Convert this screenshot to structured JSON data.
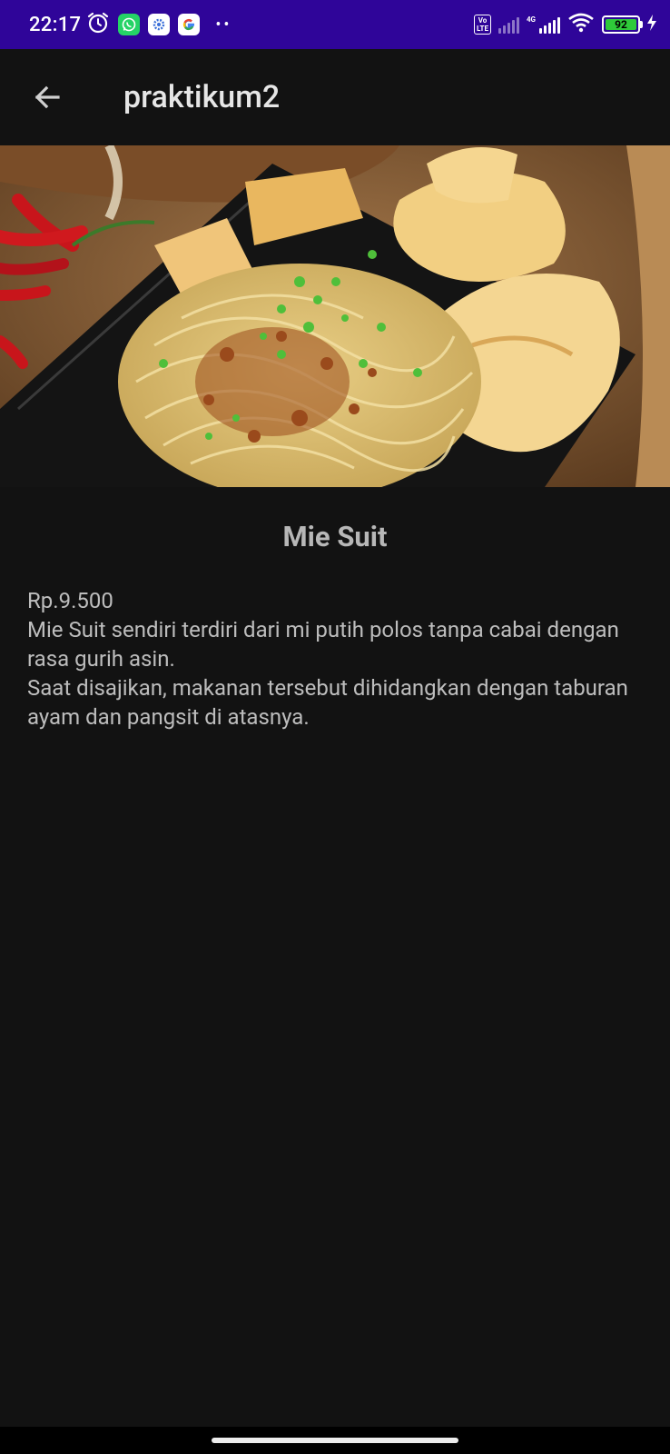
{
  "status_bar": {
    "time": "22:17",
    "icons": [
      "alarm-icon",
      "whatsapp-icon",
      "settings-app-icon",
      "google-icon"
    ],
    "more_dots": "••",
    "volte": "Vo\nLTE",
    "network": "4G",
    "battery_level": "92",
    "charging": true
  },
  "app_bar": {
    "back_icon": "arrow-back-icon",
    "title": "praktikum2"
  },
  "detail": {
    "image_subject": "Mie Suit",
    "name": "Mie Suit",
    "price": "Rp.9.500",
    "description_line1": "Mie Suit sendiri terdiri dari mi putih polos tanpa cabai dengan rasa gurih asin.",
    "description_line2": "Saat disajikan, makanan tersebut dihidangkan dengan taburan ayam dan pangsit di atasnya."
  },
  "colors": {
    "status_bar": "#2f0599",
    "background": "#121212",
    "battery_fill": "#2fcb3a"
  }
}
